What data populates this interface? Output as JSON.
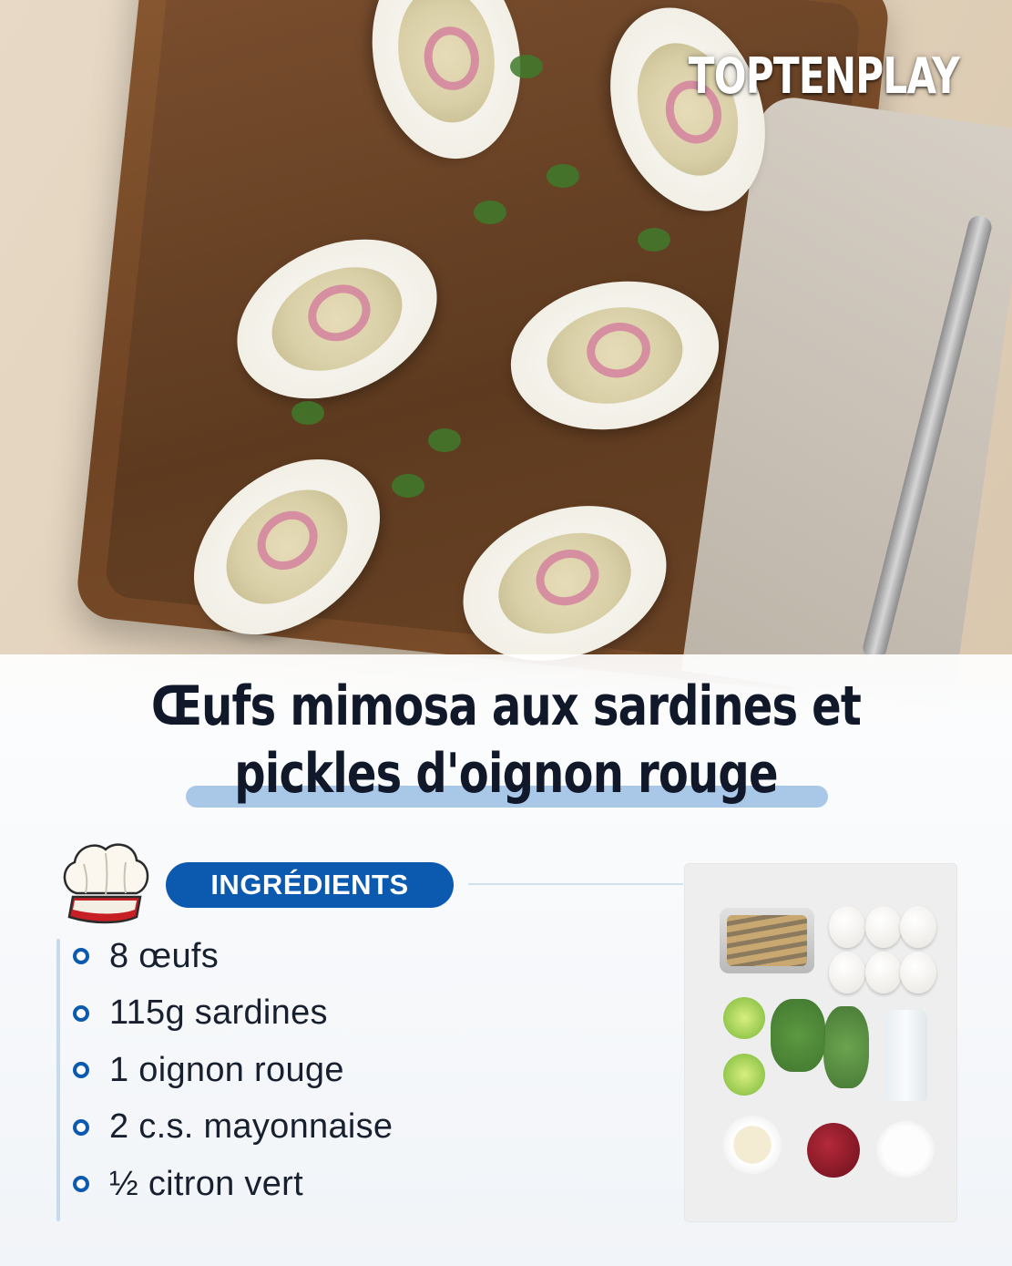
{
  "brand": "TOPTENPLAY",
  "recipe": {
    "title_line1": "Œufs mimosa aux sardines et",
    "title_line2": "pickles d'oignon rouge"
  },
  "ingredients_section": {
    "label": "INGRÉDIENTS",
    "items": [
      "8 œufs",
      "115g sardines",
      "1 oignon rouge",
      "2 c.s. mayonnaise",
      "½ citron vert"
    ]
  },
  "colors": {
    "accent": "#0c5ab0",
    "title": "#10182a",
    "highlight": "#a9c8e8"
  },
  "icons": {
    "chef_hat": "chef-hat-icon"
  }
}
